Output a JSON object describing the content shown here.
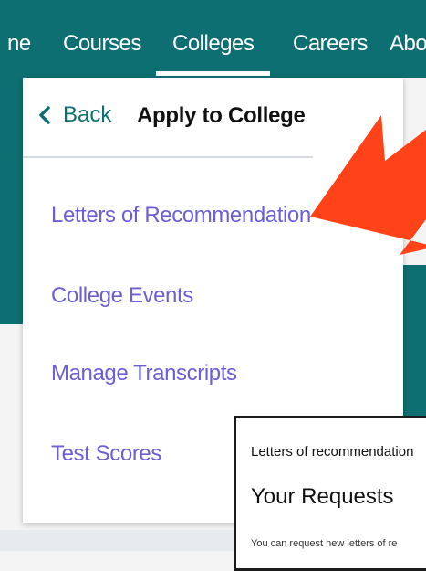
{
  "nav": {
    "items": [
      {
        "label": "ne",
        "active": false
      },
      {
        "label": "Courses",
        "active": false
      },
      {
        "label": "Colleges",
        "active": true
      },
      {
        "label": "Careers",
        "active": false
      },
      {
        "label": "Abo",
        "active": false
      }
    ]
  },
  "menu": {
    "back_label": "Back",
    "title": "Apply to College",
    "links": [
      "Letters of Recommendation",
      "College Events",
      "Manage Transcripts",
      "Test Scores"
    ]
  },
  "card": {
    "label": "Letters of recommendation",
    "heading": "Your Requests",
    "body": "You can request new letters of re"
  },
  "colors": {
    "nav_bg": "#0e6f72",
    "link": "#6c5fd6",
    "arrow": "#fe4319",
    "accent": "#0e6f72"
  },
  "icons": {
    "back": "chevron-left-icon",
    "annotation": "red-arrow"
  }
}
